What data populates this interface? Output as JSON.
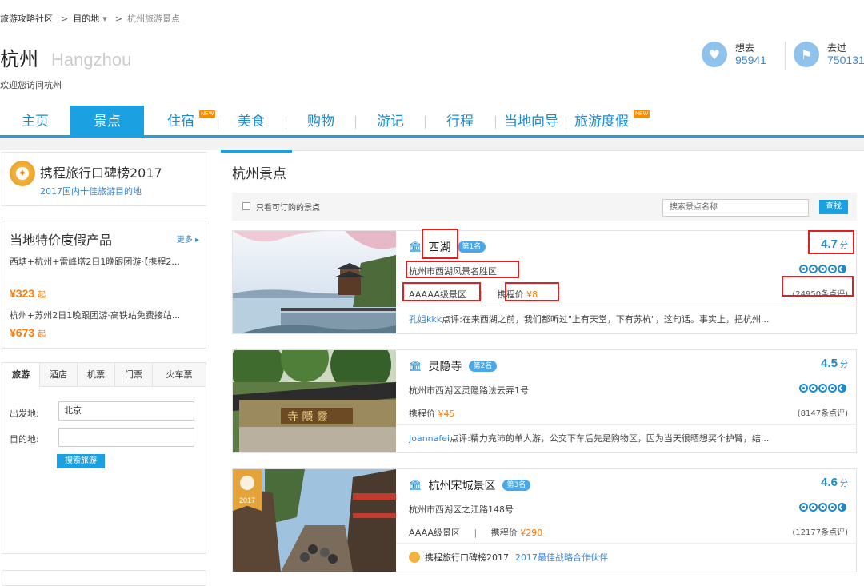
{
  "breadcrumb": {
    "root": "旅游攻略社区",
    "sep": ">",
    "dest": "目的地",
    "caret": "▾",
    "current": "杭州旅游景点"
  },
  "city": {
    "name_cn": "杭州",
    "name_en": "Hangzhou",
    "welcome": "欢迎您访问杭州"
  },
  "stats": {
    "want_label": "想去",
    "want_count": "95941",
    "been_label": "去过",
    "been_count": "750131"
  },
  "nav": {
    "items": [
      "主页",
      "景点",
      "住宿",
      "美食",
      "购物",
      "游记",
      "行程",
      "当地向导",
      "旅游度假"
    ],
    "active": "景点",
    "new_tag": "NEW"
  },
  "sidebar": {
    "award": {
      "title": "携程旅行口碑榜2017",
      "subtitle": "2017国内十佳旅游目的地"
    },
    "deals": {
      "heading": "当地特价度假产品",
      "more": "更多 ▸",
      "items": [
        {
          "title": "西塘+杭州+雷峰塔2日1晚跟团游·【携程2...",
          "price": "¥323",
          "suffix": "起"
        },
        {
          "title": "杭州+苏州2日1晚跟团游·高铁站免费接站...",
          "price": "¥673",
          "suffix": "起"
        }
      ]
    },
    "search": {
      "tabs": [
        "旅游",
        "酒店",
        "机票",
        "门票",
        "火车票"
      ],
      "from_label": "出发地:",
      "from_value": "北京",
      "to_label": "目的地:",
      "to_value": "",
      "button": "搜索旅游"
    }
  },
  "main": {
    "heading": "杭州景点",
    "filter_label": "只看可订购的景点",
    "search_placeholder": "搜索景点名称",
    "search_button": "查找",
    "score_unit": "分",
    "cards": [
      {
        "name": "西湖",
        "rank": "第1名",
        "address": "杭州市西湖风景名胜区",
        "level": "AAAAA级景区",
        "price_label": "携程价",
        "price": "¥8",
        "score": "4.7",
        "reviews": "(24950条点评)",
        "comment_user": "孔姐kkk",
        "comment_tag": "点评:",
        "comment": "在来西湖之前，我们都听过\"上有天堂，下有苏杭\"，这句话。事实上，把杭州..."
      },
      {
        "name": "灵隐寺",
        "rank": "第2名",
        "address": "杭州市西湖区灵隐路法云弄1号",
        "level": "",
        "price_label": "携程价",
        "price": "¥45",
        "score": "4.5",
        "reviews": "(8147条点评)",
        "comment_user": "Joannafei",
        "comment_tag": "点评:",
        "comment": "精力充沛的单人游，公交下车后先是购物区，因为当天很晒想买个护臂，结..."
      },
      {
        "name": "杭州宋城景区",
        "rank": "第3名",
        "address": "杭州市西湖区之江路148号",
        "level": "AAAA级景区",
        "price_label": "携程价",
        "price": "¥290",
        "score": "4.6",
        "reviews": "(12177条点评)",
        "badge_year": "2017",
        "award_title": "携程旅行口碑榜2017",
        "award_desc": "2017最佳战略合作伙伴"
      }
    ]
  },
  "colors": {
    "accent": "#1ba0e2",
    "link": "#3a86d0",
    "price": "#ff7a00",
    "highlight": "#e02020"
  }
}
